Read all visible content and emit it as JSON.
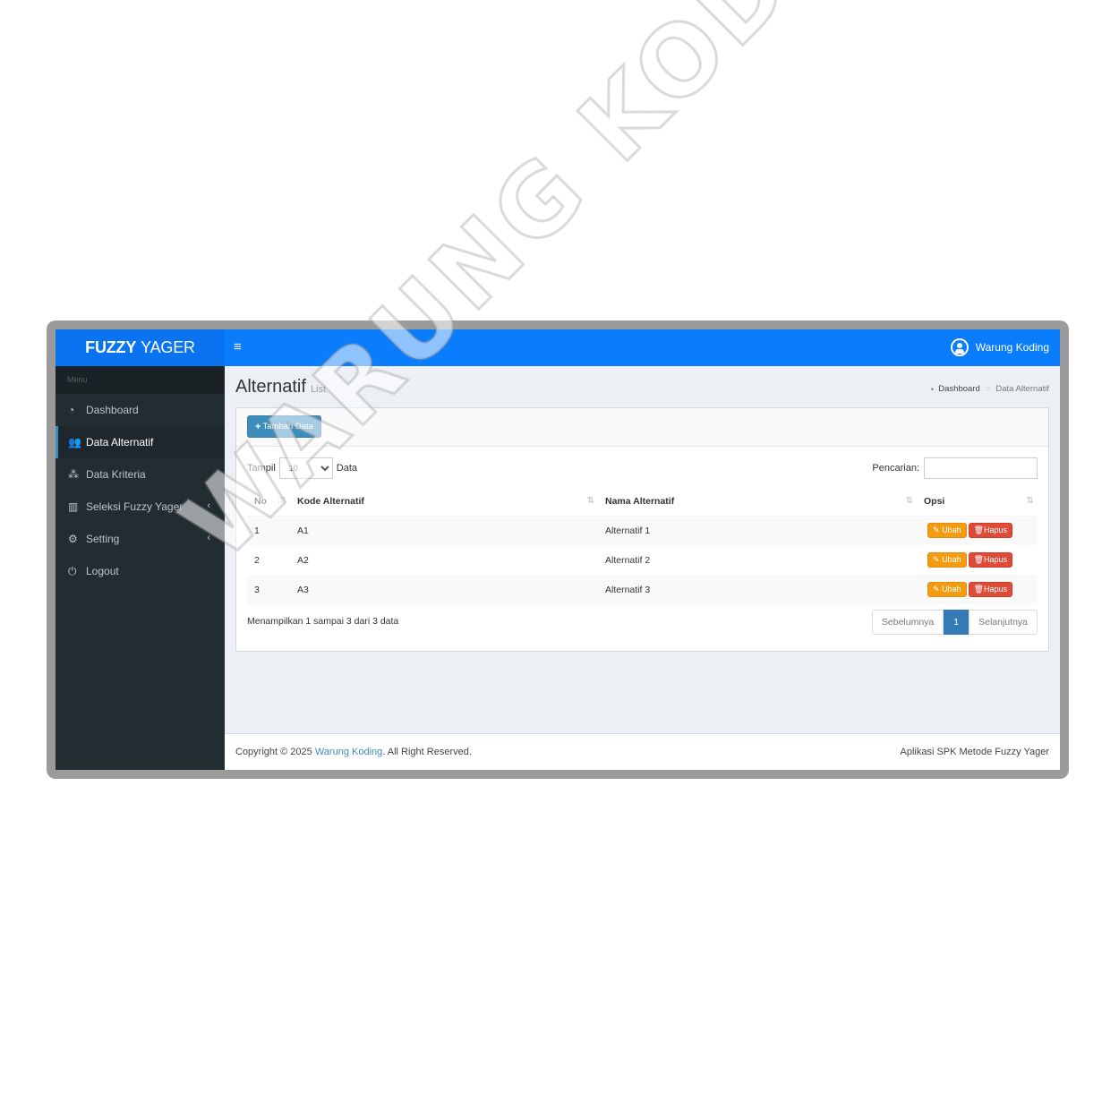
{
  "brand": {
    "bold": "FUZZY",
    "rest": "YAGER"
  },
  "header": {
    "toggle_icon": "hamburger-icon",
    "user_name": "Warung Koding"
  },
  "sidebar": {
    "menu_header": "Menu",
    "items": [
      {
        "label": "Dashboard",
        "icon": "dashboard-icon"
      },
      {
        "label": "Data Alternatif",
        "icon": "users-icon",
        "active": true
      },
      {
        "label": "Data Kriteria",
        "icon": "cubes-icon"
      },
      {
        "label": "Seleksi Fuzzy Yager",
        "icon": "bar-chart-icon",
        "has_submenu": true
      },
      {
        "label": "Setting",
        "icon": "gear-icon",
        "has_submenu": true
      },
      {
        "label": "Logout",
        "icon": "power-icon"
      }
    ]
  },
  "page": {
    "title": "Alternatif",
    "subtitle": "List"
  },
  "breadcrumb": {
    "home": "Dashboard",
    "current": "Data Alternatif"
  },
  "toolbar": {
    "add_label": "Tambah Data"
  },
  "table_controls": {
    "show_label": "Tampil",
    "show_value": "10",
    "show_suffix": "Data",
    "search_label": "Pencarian:",
    "search_value": ""
  },
  "table": {
    "columns": [
      "No",
      "Kode Alternatif",
      "Nama Alternatif",
      "Opsi"
    ],
    "rows": [
      {
        "no": "1",
        "kode": "A1",
        "nama": "Alternatif 1"
      },
      {
        "no": "2",
        "kode": "A2",
        "nama": "Alternatif 2"
      },
      {
        "no": "3",
        "kode": "A3",
        "nama": "Alternatif 3"
      }
    ],
    "edit_label": "Ubah",
    "delete_label": "Hapus"
  },
  "pagination": {
    "info": "Menampilkan 1 sampai 3 dari 3 data",
    "prev": "Sebelumnya",
    "current": "1",
    "next": "Selanjutnya"
  },
  "footer": {
    "copyright_prefix": "Copyright © 2025",
    "link": "Warung Koding",
    "copyright_suffix": ". All Right Reserved.",
    "app_name": "Aplikasi SPK Metode Fuzzy Yager"
  },
  "watermark": "WARUNG KODING",
  "colors": {
    "header": "#0a7dfd",
    "sidebar": "#222d32",
    "primary_button": "#3c8dbc",
    "edit_button": "#f39c12",
    "delete_button": "#dd4b39"
  }
}
